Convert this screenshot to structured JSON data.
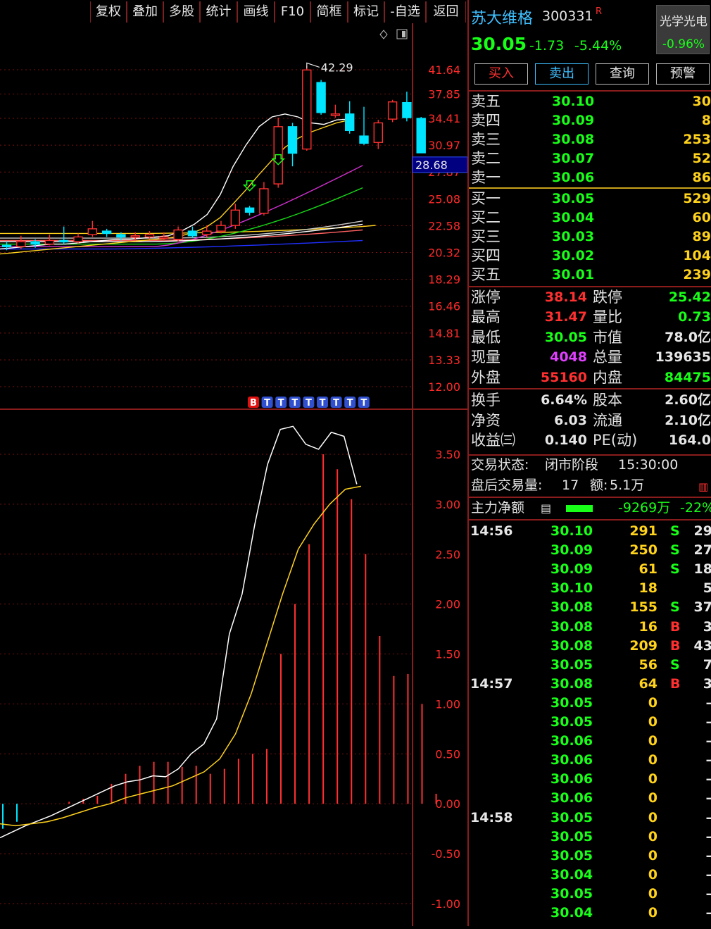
{
  "toolbar": {
    "items": [
      "复权",
      "叠加",
      "多股",
      "统计",
      "画线",
      "F10",
      "简框",
      "标记",
      "-自选",
      "返回"
    ]
  },
  "chart": {
    "price_labels": [
      "41.64",
      "37.85",
      "34.41",
      "30.97",
      "27.87",
      "25.08",
      "22.58",
      "20.32",
      "18.29",
      "16.46",
      "14.81",
      "13.33",
      "12.00"
    ],
    "current_price_tag": "28.68",
    "high_annotation": "42.29",
    "signal_badges": [
      "B",
      "T",
      "T",
      "T",
      "T",
      "T",
      "T",
      "T",
      "T"
    ],
    "indicator_labels": [
      "3.50",
      "3.00",
      "2.50",
      "2.00",
      "1.50",
      "1.00",
      "0.50",
      "0.00",
      "-0.50",
      "-1.00"
    ],
    "colors": {
      "up": "#ff3030",
      "down": "#00e5ff",
      "grid": "#7a1010",
      "axis": "#ff2a2a"
    }
  },
  "stock": {
    "name": "苏大维格",
    "code": "300331",
    "flag": "R",
    "price": "30.05",
    "change": "-1.73",
    "change_pct": "-5.44%",
    "sector_name": "光学光电",
    "sector_change": "-0.96%"
  },
  "actions": {
    "buy": "买入",
    "sell": "卖出",
    "query": "查询",
    "alert": "预警"
  },
  "order_book": {
    "asks": [
      {
        "label": "卖五",
        "price": "30.10",
        "vol": "30"
      },
      {
        "label": "卖四",
        "price": "30.09",
        "vol": "8"
      },
      {
        "label": "卖三",
        "price": "30.08",
        "vol": "253"
      },
      {
        "label": "卖二",
        "price": "30.07",
        "vol": "52"
      },
      {
        "label": "卖一",
        "price": "30.06",
        "vol": "86"
      }
    ],
    "bids": [
      {
        "label": "买一",
        "price": "30.05",
        "vol": "529"
      },
      {
        "label": "买二",
        "price": "30.04",
        "vol": "60"
      },
      {
        "label": "买三",
        "price": "30.03",
        "vol": "89"
      },
      {
        "label": "买四",
        "price": "30.02",
        "vol": "104"
      },
      {
        "label": "买五",
        "price": "30.01",
        "vol": "239"
      }
    ]
  },
  "stats": [
    {
      "l1": "涨停",
      "v1": "38.14",
      "l2": "跌停",
      "v2": "25.42"
    },
    {
      "l1": "最高",
      "v1": "31.47",
      "l2": "量比",
      "v2": "0.73"
    },
    {
      "l1": "最低",
      "v1": "30.05",
      "l2": "市值",
      "v2": "78.0亿"
    },
    {
      "l1": "现量",
      "v1": "4048",
      "l2": "总量",
      "v2": "139635"
    },
    {
      "l1": "外盘",
      "v1": "55160",
      "l2": "内盘",
      "v2": "84475"
    }
  ],
  "fundamentals": [
    {
      "l1": "换手",
      "v1": "6.64%",
      "l2": "股本",
      "v2": "2.60亿"
    },
    {
      "l1": "净资",
      "v1": "6.03",
      "l2": "流通",
      "v2": "2.10亿"
    },
    {
      "l1": "收益㈢",
      "v1": "0.140",
      "l2": "PE(动)",
      "v2": "164.0"
    }
  ],
  "status": {
    "trade_state_label": "交易状态:",
    "trade_state": "闭市阶段",
    "trade_time": "15:30:00",
    "after_hours_label": "盘后交易量:",
    "after_hours_vol": "17",
    "after_hours_amt_label": "额:",
    "after_hours_amt": "5.1万"
  },
  "main_force": {
    "label": "主力净额",
    "amount": "-9269万",
    "pct": "-22%"
  },
  "ticks": [
    {
      "time": "14:56",
      "price": "30.10",
      "vol": "291",
      "side": "S",
      "num": "29"
    },
    {
      "time": "",
      "price": "30.09",
      "vol": "250",
      "side": "S",
      "num": "27"
    },
    {
      "time": "",
      "price": "30.09",
      "vol": "61",
      "side": "S",
      "num": "18"
    },
    {
      "time": "",
      "price": "30.10",
      "vol": "18",
      "side": "",
      "num": "5"
    },
    {
      "time": "",
      "price": "30.08",
      "vol": "155",
      "side": "S",
      "num": "37"
    },
    {
      "time": "",
      "price": "30.08",
      "vol": "16",
      "side": "B",
      "num": "3"
    },
    {
      "time": "",
      "price": "30.08",
      "vol": "209",
      "side": "B",
      "num": "43"
    },
    {
      "time": "",
      "price": "30.05",
      "vol": "56",
      "side": "S",
      "num": "7"
    },
    {
      "time": "14:57",
      "price": "30.08",
      "vol": "64",
      "side": "B",
      "num": "3"
    },
    {
      "time": "",
      "price": "30.05",
      "vol": "0",
      "side": "",
      "num": "–"
    },
    {
      "time": "",
      "price": "30.05",
      "vol": "0",
      "side": "",
      "num": "–"
    },
    {
      "time": "",
      "price": "30.06",
      "vol": "0",
      "side": "",
      "num": "–"
    },
    {
      "time": "",
      "price": "30.06",
      "vol": "0",
      "side": "",
      "num": "–"
    },
    {
      "time": "",
      "price": "30.06",
      "vol": "0",
      "side": "",
      "num": "–"
    },
    {
      "time": "",
      "price": "30.06",
      "vol": "0",
      "side": "",
      "num": "–"
    },
    {
      "time": "14:58",
      "price": "30.05",
      "vol": "0",
      "side": "",
      "num": "–"
    },
    {
      "time": "",
      "price": "30.05",
      "vol": "0",
      "side": "",
      "num": "–"
    },
    {
      "time": "",
      "price": "30.05",
      "vol": "0",
      "side": "",
      "num": "–"
    },
    {
      "time": "",
      "price": "30.04",
      "vol": "0",
      "side": "",
      "num": "–"
    },
    {
      "time": "",
      "price": "30.05",
      "vol": "0",
      "side": "",
      "num": "–"
    },
    {
      "time": "",
      "price": "30.04",
      "vol": "0",
      "side": "",
      "num": "–"
    }
  ],
  "chart_data": {
    "type": "candlestick",
    "price_axis": [
      12.0,
      41.64
    ],
    "candles": [
      {
        "open": 20.8,
        "close": 20.9,
        "high": 21.3,
        "low": 20.4
      },
      {
        "open": 20.9,
        "close": 20.8,
        "high": 21.2,
        "low": 20.5
      },
      {
        "open": 20.8,
        "close": 21.2,
        "high": 21.7,
        "low": 20.6
      },
      {
        "open": 21.2,
        "close": 21.0,
        "high": 21.4,
        "low": 20.7
      },
      {
        "open": 21.0,
        "close": 21.3,
        "high": 21.8,
        "low": 20.9
      },
      {
        "open": 21.3,
        "close": 21.2,
        "high": 22.5,
        "low": 21.0
      },
      {
        "open": 21.2,
        "close": 21.6,
        "high": 21.9,
        "low": 21.0
      },
      {
        "open": 21.8,
        "close": 22.3,
        "high": 23.0,
        "low": 21.6
      },
      {
        "open": 22.1,
        "close": 21.9,
        "high": 22.3,
        "low": 21.6
      },
      {
        "open": 21.8,
        "close": 21.6,
        "high": 22.0,
        "low": 21.3
      },
      {
        "open": 21.6,
        "close": 21.7,
        "high": 22.0,
        "low": 21.3
      },
      {
        "open": 21.6,
        "close": 21.8,
        "high": 22.1,
        "low": 21.4
      },
      {
        "open": 21.6,
        "close": 21.6,
        "high": 22.0,
        "low": 21.3
      },
      {
        "open": 21.4,
        "close": 22.2,
        "high": 22.5,
        "low": 21.2
      },
      {
        "open": 22.1,
        "close": 21.7,
        "high": 22.5,
        "low": 21.5
      },
      {
        "open": 21.8,
        "close": 22.1,
        "high": 22.6,
        "low": 21.6
      },
      {
        "open": 22.1,
        "close": 22.6,
        "high": 23.0,
        "low": 21.9
      },
      {
        "open": 22.6,
        "close": 24.0,
        "high": 24.6,
        "low": 22.3
      },
      {
        "open": 24.2,
        "close": 23.8,
        "high": 24.4,
        "low": 23.5
      },
      {
        "open": 23.7,
        "close": 26.1,
        "high": 26.8,
        "low": 23.5
      },
      {
        "open": 26.6,
        "close": 33.3,
        "high": 34.5,
        "low": 26.2
      },
      {
        "open": 33.3,
        "close": 30.0,
        "high": 33.8,
        "low": 28.5
      },
      {
        "open": 30.5,
        "close": 41.6,
        "high": 42.29,
        "low": 30.3
      },
      {
        "open": 39.6,
        "close": 35.2,
        "high": 40.0,
        "low": 34.9
      },
      {
        "open": 34.9,
        "close": 35.0,
        "high": 36.3,
        "low": 34.5
      },
      {
        "open": 35.0,
        "close": 32.8,
        "high": 36.8,
        "low": 32.4
      },
      {
        "open": 32.1,
        "close": 31.2,
        "high": 36.0,
        "low": 31.0
      },
      {
        "open": 31.3,
        "close": 33.8,
        "high": 34.2,
        "low": 30.5
      },
      {
        "open": 34.3,
        "close": 36.7,
        "high": 37.0,
        "low": 33.9
      },
      {
        "open": 36.6,
        "close": 34.5,
        "high": 38.2,
        "low": 34.0
      },
      {
        "open": 34.4,
        "close": 30.05,
        "high": 34.6,
        "low": 30.05
      }
    ],
    "indicator_axis": [
      -1.0,
      3.5
    ],
    "indicator_bars": [
      0.0,
      0.0,
      0.0,
      0.0,
      0.0,
      0.02,
      0.05,
      0.08,
      0.2,
      0.3,
      0.38,
      0.42,
      0.42,
      0.37,
      0.38,
      0.3,
      0.35,
      0.45,
      0.5,
      0.55,
      1.5,
      2.0,
      2.6,
      3.5,
      3.35,
      3.05,
      2.5,
      1.68,
      1.28,
      1.3,
      1.0,
      0.1
    ],
    "indicator_white": [
      -0.34,
      -0.28,
      -0.22,
      -0.17,
      -0.12,
      -0.06,
      0.0,
      0.06,
      0.12,
      0.18,
      0.22,
      0.24,
      0.28,
      0.27,
      0.35,
      0.5,
      0.6,
      0.85,
      1.7,
      2.1,
      2.8,
      3.4,
      3.75,
      3.78,
      3.6,
      3.55,
      3.72,
      3.68,
      3.2
    ],
    "indicator_yellow": [
      -0.2,
      -0.22,
      -0.2,
      -0.18,
      -0.14,
      -0.09,
      -0.04,
      0.0,
      0.06,
      0.1,
      0.14,
      0.18,
      0.25,
      0.32,
      0.45,
      0.7,
      1.1,
      1.6,
      2.1,
      2.55,
      2.8,
      3.0,
      3.15,
      3.18
    ]
  }
}
